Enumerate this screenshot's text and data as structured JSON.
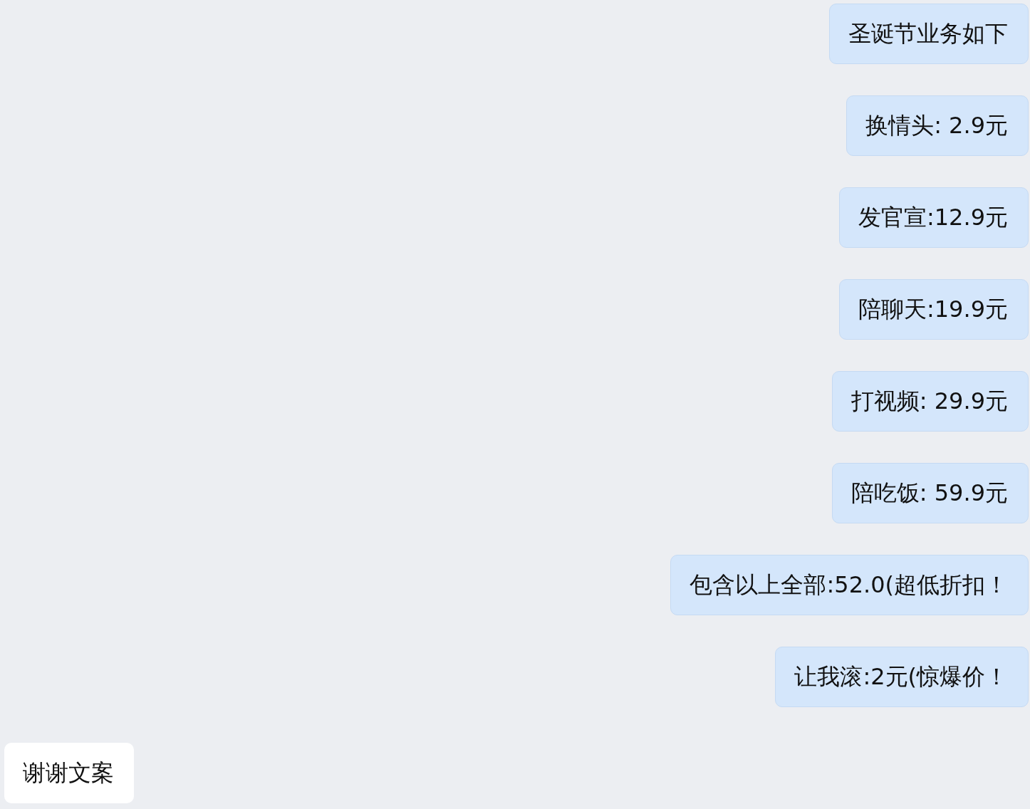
{
  "messages": [
    {
      "kind": "sent",
      "text": "圣诞节业务如下"
    },
    {
      "kind": "sent",
      "text": "换情头: 2.9元"
    },
    {
      "kind": "sent",
      "text": "发官宣:12.9元"
    },
    {
      "kind": "sent",
      "text": "陪聊天:19.9元"
    },
    {
      "kind": "sent",
      "text": "打视频: 29.9元"
    },
    {
      "kind": "sent",
      "text": "陪吃饭: 59.9元"
    },
    {
      "kind": "sent",
      "text": "包含以上全部:52.0(超低折扣！"
    },
    {
      "kind": "sent",
      "text": "让我滚:2元(惊爆价！"
    },
    {
      "kind": "received",
      "text": "谢谢文案"
    }
  ]
}
